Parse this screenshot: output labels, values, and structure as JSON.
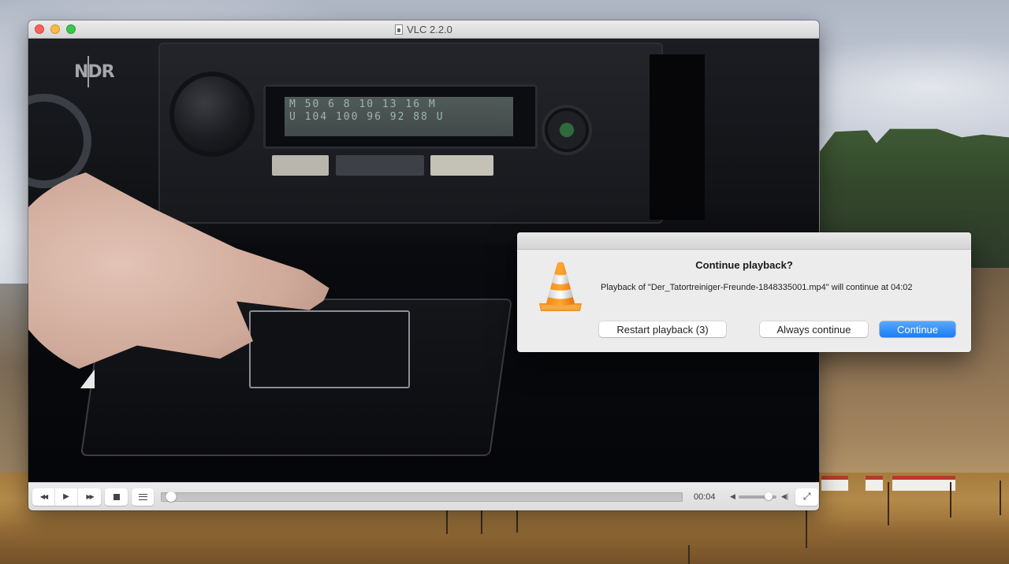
{
  "window": {
    "title": "VLC 2.2.0",
    "traffic_lights": {
      "close": "close",
      "minimize": "minimize",
      "zoom": "zoom"
    }
  },
  "video": {
    "channel_logo": "NDR",
    "lcd_line1": "M 50 6 8 10 13 16 M",
    "lcd_line2": "U 104 100 96 92 88 U"
  },
  "controls": {
    "rewind_icon": "◀◀",
    "play_icon": "▶",
    "forward_icon": "▶▶",
    "elapsed_time": "00:04",
    "seek_progress_fraction": 0.01,
    "volume_fraction": 0.8,
    "vol_min_icon": "◀",
    "vol_max_icon": "◀|",
    "fullscreen_icon": "⤢"
  },
  "dialog": {
    "title": "Continue playback?",
    "message": "Playback of \"Der_Tatortreiniger-Freunde-1848335001.mp4\" will continue at 04:02",
    "buttons": {
      "restart": "Restart playback (3)",
      "always": "Always continue",
      "continue": "Continue"
    },
    "accent_color": "#1a7cf5"
  }
}
